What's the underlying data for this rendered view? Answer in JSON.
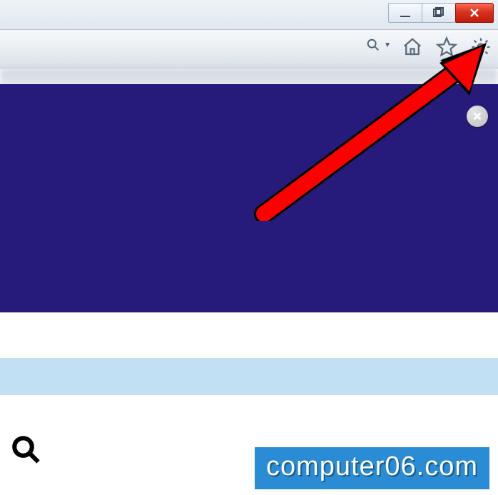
{
  "window": {
    "controls": {
      "minimize": "minimize",
      "maximize": "maximize",
      "close": "close"
    }
  },
  "toolbar": {
    "search_dropdown": "search",
    "icons": {
      "home": "home-icon",
      "favorites": "star-icon",
      "tools": "gear-icon"
    }
  },
  "panel": {
    "close": "close"
  },
  "watermark": {
    "text": "computer06.com"
  },
  "colors": {
    "panel_bg": "#261b7a",
    "lightbar": "#c2e0f4",
    "watermark_bg": "#2a8cd4",
    "arrow": "#ff0000"
  }
}
